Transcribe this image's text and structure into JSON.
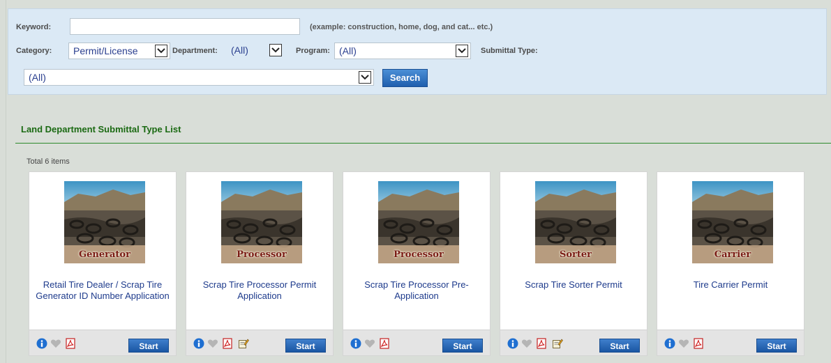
{
  "search": {
    "keyword_label": "Keyword:",
    "keyword_value": "",
    "keyword_hint": "(example: construction, home, dog, and cat... etc.)",
    "category_label": "Category:",
    "category_value": "Permit/License",
    "department_label": "Department:",
    "department_value": "(All)",
    "program_label": "Program:",
    "program_value": "(All)",
    "submittal_type_label": "Submittal Type:",
    "submittal_type_value": "(All)",
    "search_button": "Search"
  },
  "list": {
    "title": "Land Department Submittal Type List",
    "total": "Total 6 items",
    "start_label": "Start"
  },
  "cards": [
    {
      "image_caption": "Generator",
      "name": "Retail Tire Dealer / Scrap Tire Generator ID Number Application",
      "icons": [
        "info-icon",
        "favorite-heart-icon",
        "pdf-icon"
      ]
    },
    {
      "image_caption": "Processor",
      "name": "Scrap Tire Processor Permit Application",
      "icons": [
        "info-icon",
        "favorite-heart-icon",
        "pdf-icon",
        "edit-form-icon"
      ]
    },
    {
      "image_caption": "Processor",
      "name": "Scrap Tire Processor Pre-Application",
      "icons": [
        "info-icon",
        "favorite-heart-icon",
        "pdf-icon"
      ]
    },
    {
      "image_caption": "Sorter",
      "name": "Scrap Tire Sorter Permit",
      "icons": [
        "info-icon",
        "favorite-heart-icon",
        "pdf-icon",
        "edit-form-icon"
      ]
    },
    {
      "image_caption": "Carrier",
      "name": "Tire Carrier Permit",
      "icons": [
        "info-icon",
        "favorite-heart-icon",
        "pdf-icon"
      ]
    }
  ],
  "colors": {
    "panel_bg": "#dbe9f5",
    "section_title": "#1b6a13",
    "link_text": "#1e3b8c",
    "button_blue": "#1f5fae",
    "page_bg": "#d9ded8"
  }
}
